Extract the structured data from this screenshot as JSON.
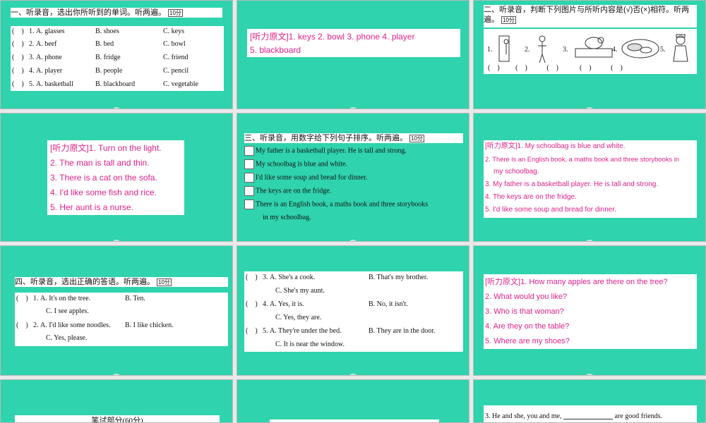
{
  "slides": {
    "s1": {
      "heading": "一、听录音，选出你所听到的单词。听两遍。",
      "tip": "10分",
      "rows": [
        {
          "num": "1.",
          "a": "A. glasses",
          "b": "B. shoes",
          "c": "C. keys"
        },
        {
          "num": "2.",
          "a": "A. beef",
          "b": "B. bed",
          "c": "C. bowl"
        },
        {
          "num": "3.",
          "a": "A. phone",
          "b": "B. fridge",
          "c": "C. friend"
        },
        {
          "num": "4.",
          "a": "A. player",
          "b": "B. people",
          "c": "C. pencil"
        },
        {
          "num": "5.",
          "a": "A. basketball",
          "b": "B. blackboard",
          "c": "C. vegetable"
        }
      ]
    },
    "s2": {
      "label": "[听力原文]",
      "line1": "1. keys   2. bowl   3. phone   4. player",
      "line2": "5. blackboard"
    },
    "s3": {
      "heading1": "二、听录音，判断下列图片与所听内容是(√)否(×)相符。听两",
      "heading2": "遍。",
      "tip": "10分",
      "nums": [
        "1.",
        "2.",
        "3.",
        "4.",
        "5."
      ]
    },
    "s4": {
      "label": "[听力原文]",
      "lines": [
        "1. Turn on the light.",
        "2. The man is tall and thin.",
        "3. There is a cat on the sofa.",
        "4. I'd like some fish and rice.",
        "5. Her aunt is a nurse."
      ]
    },
    "s5": {
      "heading": "三、听录音，用数字给下列句子排序。听两遍。",
      "tip": "10分",
      "rows": [
        "My father is a basketball player. He is tall and strong.",
        "My schoolbag is blue and white.",
        "I'd like some soup and bread for dinner.",
        "The keys are on the fridge.",
        "There is an English book, a maths book and three storybooks"
      ],
      "cont": "in my schoolbag."
    },
    "s6": {
      "label": "[听力原文]",
      "lines": [
        "1. My schoolbag is blue and white.",
        "2. There is an English book, a maths book and three storybooks in",
        "my schoolbag.",
        "3. My father is a basketball player. He is tall and strong.",
        "4. The keys are on the fridge.",
        "5. I'd like some soup and bread for dinner."
      ]
    },
    "s7": {
      "heading": "四、听录音，选出正确的答语。听两遍。",
      "tip": "10分",
      "rows": [
        {
          "num": "1.",
          "a": "A. It's on the tree.",
          "b": "B. Ten.",
          "c": "C. I see apples."
        },
        {
          "num": "2.",
          "a": "A. I'd like some noodles.",
          "b": "B. I like chicken.",
          "c": "C. Yes, please."
        }
      ]
    },
    "s8": {
      "rows": [
        {
          "num": "3.",
          "a": "A. She's a cook.",
          "b": "B. That's my brother.",
          "c": "C. She's my aunt."
        },
        {
          "num": "4.",
          "a": "A. Yes, it is.",
          "b": "B. No, it isn't.",
          "c": "C. Yes, they are."
        },
        {
          "num": "5.",
          "a": "A. They're under the bed.",
          "b": "B. They are in the door.",
          "c": "C. It is near the window."
        }
      ]
    },
    "s9": {
      "label": "[听力原文]",
      "lines": [
        "1. How many apples are there on the tree?",
        "2. What would you like?",
        "3. Who is that woman?",
        "4. Are they on the table?",
        "5. Where are my shoes?"
      ]
    },
    "s10": {
      "text": "笔试部分(60分)"
    },
    "s12": {
      "num": "3.",
      "left": "He and she, you and me,",
      "right": "are good friends."
    }
  }
}
